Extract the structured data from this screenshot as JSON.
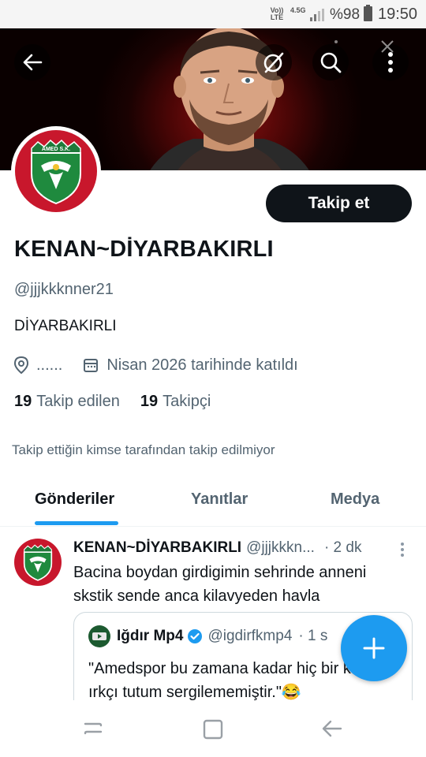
{
  "status_bar": {
    "volte_label": "Vo)) LTE",
    "network": "4.5G",
    "battery_percent": "%98",
    "time": "19:50"
  },
  "header": {
    "back_icon": "arrow-left-icon",
    "grok_icon": "grok-icon",
    "search_icon": "search-icon",
    "more_icon": "more-vertical-icon"
  },
  "profile": {
    "display_name": "KENAN~DİYARBAKIRLI",
    "handle": "@jjjkkknner21",
    "bio": "DİYARBAKIRLI",
    "location": "......",
    "joined": "Nisan 2026 tarihinde katıldı",
    "following_count": "19",
    "following_label": "Takip edilen",
    "followers_count": "19",
    "followers_label": "Takipçi",
    "follow_button_label": "Takip et",
    "not_followed_notice": "Takip ettiğin kimse tarafından takip edilmiyor",
    "avatar_text": "AMED S.K."
  },
  "tabs": [
    {
      "label": "Gönderiler",
      "active": true
    },
    {
      "label": "Yanıtlar",
      "active": false
    },
    {
      "label": "Medya",
      "active": false
    }
  ],
  "tweet": {
    "author_name": "KENAN~DİYARBAKIRLI",
    "author_handle": "@jjjkkkn...",
    "time": "· 2 dk",
    "text": "Bacina boydan girdigimin sehrinde anneni skstik sende anca kilavyeden havla",
    "quote": {
      "author_name": "Iğdır Mp4",
      "author_handle": "@igdirfkmp4",
      "time": "· 1 s",
      "text": "\"Amedspor bu zamana kadar hiç bir kulübe ırkçı tutum sergilememiştir.\"😂"
    }
  },
  "colors": {
    "accent": "#1d9bf0",
    "text_primary": "#0f1419",
    "text_secondary": "#536471",
    "avatar_red": "#c8172c"
  }
}
